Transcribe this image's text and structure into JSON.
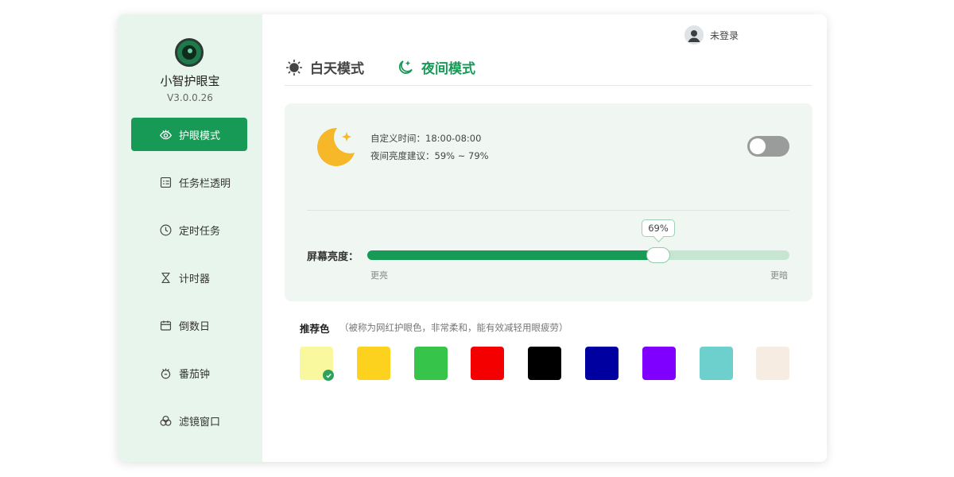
{
  "app": {
    "name": "小智护眼宝",
    "version": "V3.0.0.26"
  },
  "sidebar": {
    "items": [
      {
        "label": "护眼模式",
        "icon": "eye-icon"
      },
      {
        "label": "任务栏透明",
        "icon": "taskbar-icon"
      },
      {
        "label": "定时任务",
        "icon": "clock-icon"
      },
      {
        "label": "计时器",
        "icon": "hourglass-icon"
      },
      {
        "label": "倒数日",
        "icon": "calendar-icon"
      },
      {
        "label": "番茄钟",
        "icon": "tomato-icon"
      },
      {
        "label": "滤镜窗口",
        "icon": "filter-icon"
      }
    ],
    "active_index": 0
  },
  "header": {
    "user_label": "未登录",
    "controls": [
      "menu-icon",
      "minimize-icon",
      "close-icon"
    ]
  },
  "modes": {
    "day": {
      "label": "白天模式",
      "icon": "sun-icon"
    },
    "night": {
      "label": "夜间模式",
      "icon": "moon-icon",
      "selected": true
    }
  },
  "night_card": {
    "custom_time": "自定义时间：18:00-08:00",
    "brightness_hint": "夜间亮度建议：59% ~ 79%",
    "toggle_on": false
  },
  "brightness": {
    "label": "屏幕亮度：",
    "value_percent": 69,
    "value_text": "69%",
    "min_label": "更亮",
    "max_label": "更暗"
  },
  "recommend": {
    "title": "推荐色",
    "subtitle": "（被称为网红护眼色，非常柔和，能有效减轻用眼疲劳）",
    "colors": [
      "#faf89e",
      "#fcd21e",
      "#37c44a",
      "#f40000",
      "#000000",
      "#0000a1",
      "#8000ff",
      "#6dd0cc",
      "#f7ece2"
    ],
    "selected_index": 0
  },
  "theme": {
    "accent": "#179a56"
  }
}
